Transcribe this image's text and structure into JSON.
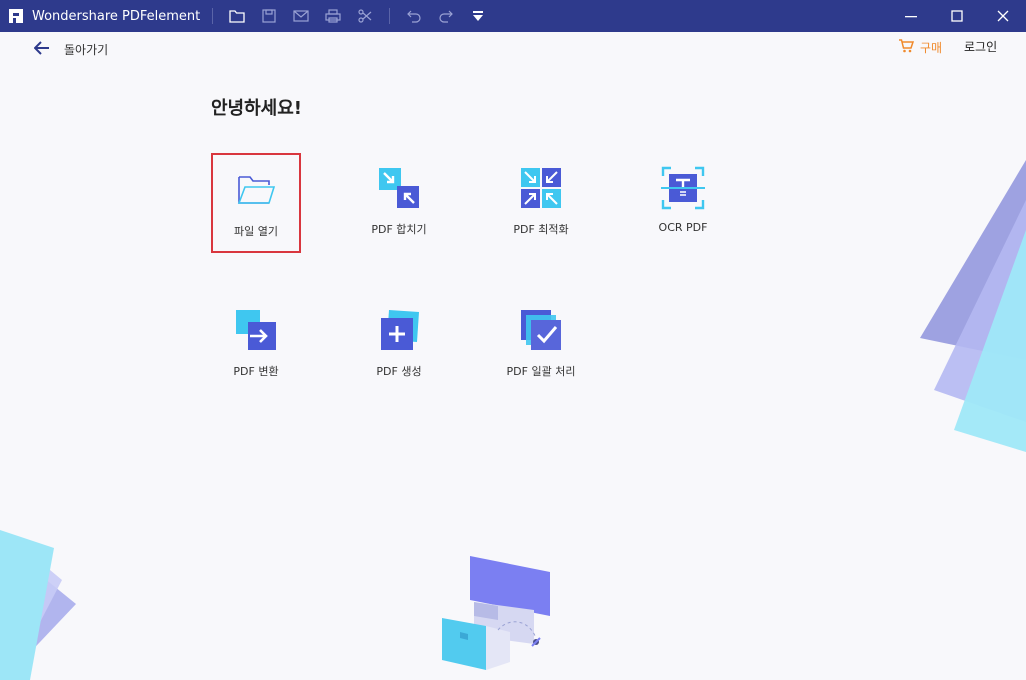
{
  "app": {
    "title": "Wondershare PDFelement"
  },
  "toolbar": {
    "icons": [
      "folder-icon",
      "save-icon",
      "mail-icon",
      "print-icon",
      "scissors-icon",
      "undo-icon",
      "redo-icon",
      "dropdown-menu-icon"
    ]
  },
  "window_controls": [
    "minimize-icon",
    "maximize-icon",
    "close-icon"
  ],
  "nav": {
    "back_label": "돌아가기",
    "buy_label": "구매",
    "login_label": "로그인"
  },
  "main": {
    "greeting": "안녕하세요!",
    "tiles": [
      {
        "label": "파일 열기",
        "icon": "open-folder-icon",
        "selected": true
      },
      {
        "label": "PDF 합치기",
        "icon": "combine-icon"
      },
      {
        "label": "PDF 최적화",
        "icon": "optimize-icon"
      },
      {
        "label": "OCR PDF",
        "icon": "ocr-icon"
      },
      {
        "label": "PDF 변환",
        "icon": "convert-icon"
      },
      {
        "label": "PDF 생성",
        "icon": "create-icon"
      },
      {
        "label": "PDF 일괄 처리",
        "icon": "batch-process-icon"
      }
    ]
  },
  "colors": {
    "titlebar": "#2e3a8c",
    "accent_orange": "#f08a2c",
    "selected_border": "#d9363e",
    "icon_blue": "#4a5ad6",
    "icon_cyan": "#3fc7f0"
  }
}
